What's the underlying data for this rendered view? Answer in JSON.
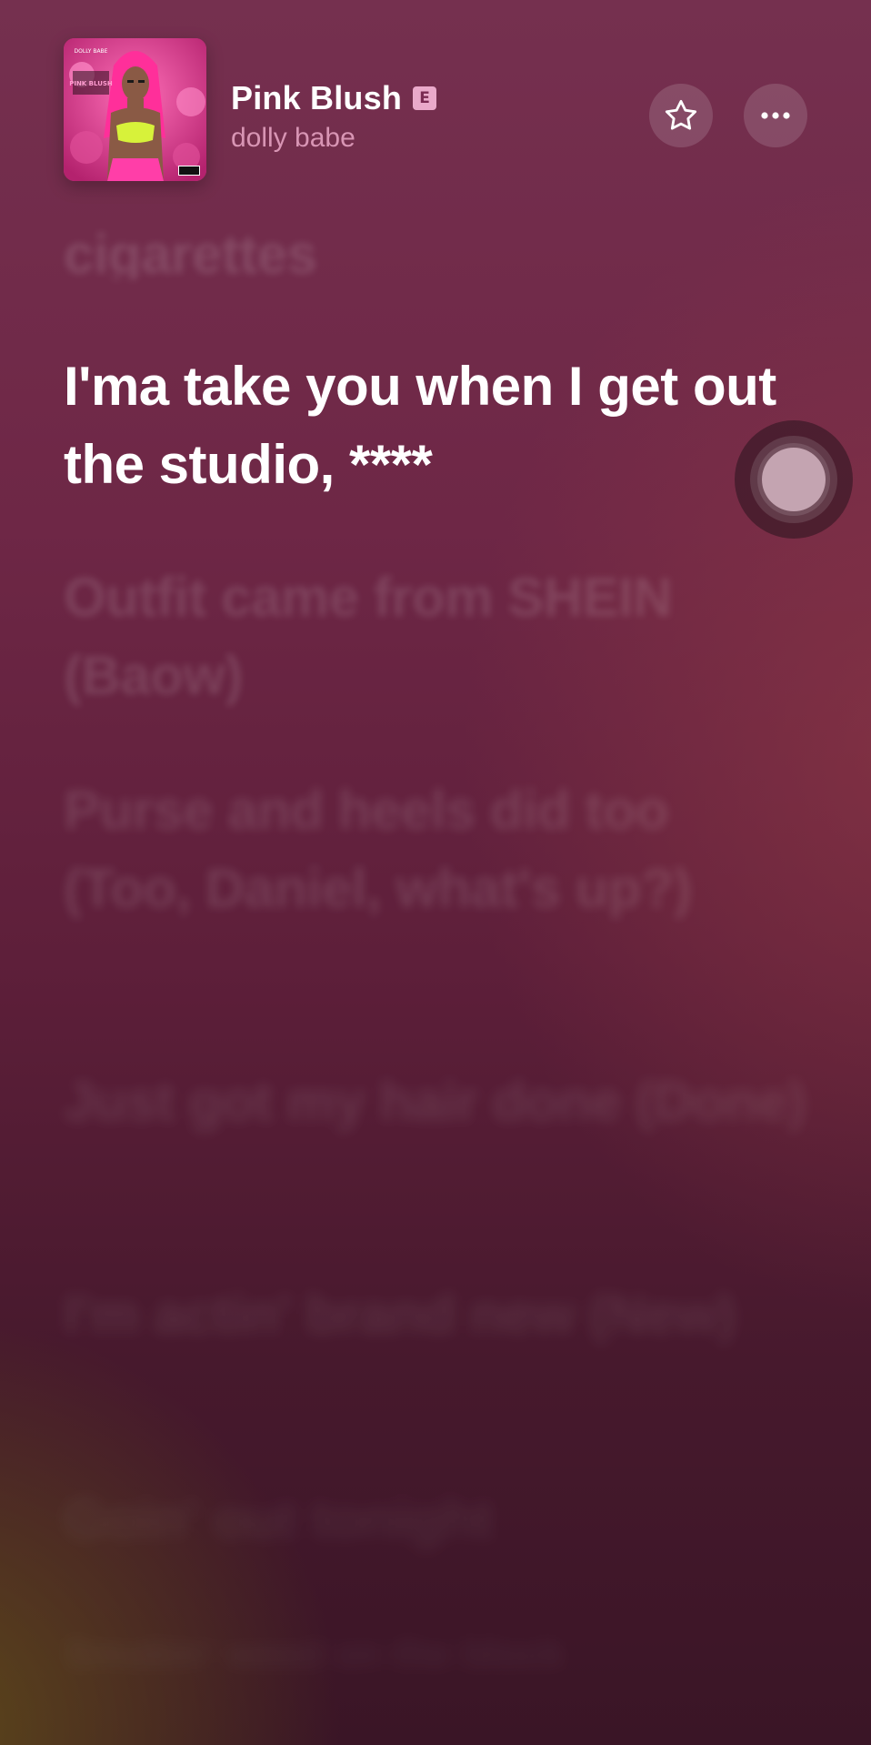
{
  "now_playing": {
    "title": "Pink Blush",
    "explicit_badge": "E",
    "artist": "dolly babe",
    "artwork": {
      "icon": "album-artwork",
      "header_text": "DOLLY BABE",
      "title_text": "PINK BLUSH"
    }
  },
  "actions": {
    "favorite_icon": "star-icon",
    "more_icon": "ellipsis-icon"
  },
  "lyrics": {
    "previous_line": "cigarettes",
    "current_line": "I'ma take you when I get out the studio, ****",
    "upcoming": [
      "Outfit came from SHEIN (Baow)",
      "Purse and heels did too (Too, Daniel, what's up?)",
      "Just got my hair done (Done)",
      "I'm actin' brand new (New)",
      "Goin' out tonight",
      "Smokin' weed on the block"
    ]
  },
  "colors": {
    "background_top": "#75304f",
    "background_bottom": "#3a1526",
    "accent_pink": "#d9338a",
    "badge": "#ffbee1"
  }
}
